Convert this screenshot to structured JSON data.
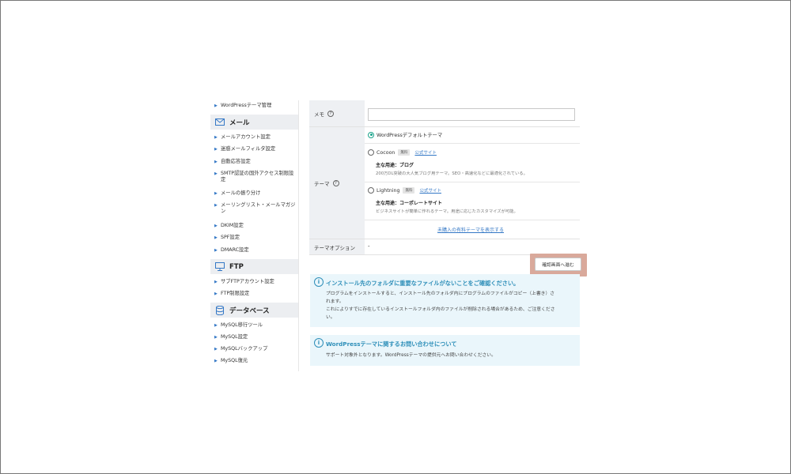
{
  "sidebar": {
    "top_item": "WordPressテーマ管理",
    "sections": [
      {
        "title": "メール",
        "icon": "mail-icon",
        "items": [
          "メールアカウント設定",
          "迷惑メールフィルタ設定",
          "自動応答設定",
          "SMTP認証の国外アクセス制限設定",
          "メールの振り分け",
          "メーリングリスト・メールマガジン",
          "DKIM設定",
          "SPF設定",
          "DMARC設定"
        ]
      },
      {
        "title": "FTP",
        "icon": "monitor-icon",
        "items": [
          "サブFTPアカウント設定",
          "FTP制限設定"
        ]
      },
      {
        "title": "データベース",
        "icon": "database-icon",
        "items": [
          "MySQL移行ツール",
          "MySQL設定",
          "MySQLバックアップ",
          "MySQL復元"
        ]
      }
    ]
  },
  "form": {
    "memo_label": "メモ",
    "memo_value": "",
    "theme_label": "テーマ",
    "help_glyph": "?",
    "options": [
      {
        "name": "WordPressデフォルトテーマ",
        "selected": true
      },
      {
        "name": "Cocoon",
        "badge": "無料",
        "link": "公式サイト",
        "usage": "主な用途：ブログ",
        "desc": "200万DL突破の大人気ブログ用テーマ。SEO・高速化などに最適化されている。",
        "selected": false
      },
      {
        "name": "Lightning",
        "badge": "無料",
        "link": "公式サイト",
        "usage": "主な用途：コーポレートサイト",
        "desc": "ビジネスサイトが簡単に作れるテーマ。用途に応じたカスタマイズが可能。",
        "selected": false
      }
    ],
    "paid_link": "未購入の有料テーマを表示する",
    "theme_option_label": "テーマオプション",
    "theme_option_value": "-",
    "confirm_button": "確認画面へ進む"
  },
  "notices": [
    {
      "title": "インストール先のフォルダに重要なファイルがないことをご確認ください。",
      "lines": [
        "プログラムをインストールすると、インストール先のフォルダ内にプログラムのファイルがコピー（上書き）さ",
        "れます。",
        "これによりすでに存在しているインストールフォルダ内のファイルが削除される場合があるため、ご注意くださ",
        "い。"
      ]
    },
    {
      "title": "WordPressテーマに関するお問い合わせについて",
      "lines": [
        "サポート対象外となります。WordPressテーマの提供元へお問い合わせください。"
      ]
    }
  ],
  "colors": {
    "accent_link": "#3478c6",
    "radio_selected": "#1aa38a",
    "info_bg": "#eaf6fb",
    "info_text": "#2e8fb9",
    "highlight_border": "#d9a99b"
  }
}
